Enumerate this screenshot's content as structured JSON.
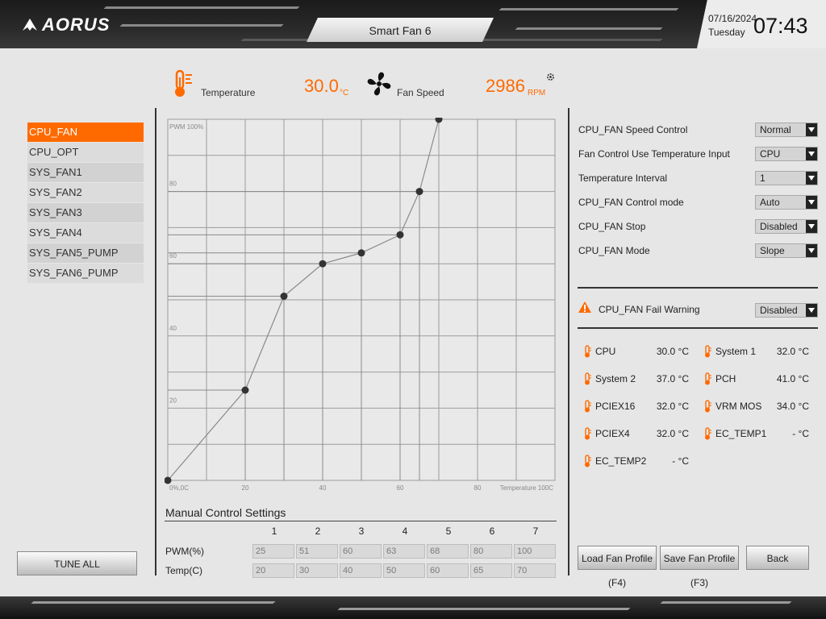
{
  "header": {
    "brand": "AORUS",
    "page_title": "Smart Fan 6",
    "date": "07/16/2024",
    "day": "Tuesday",
    "time": "07:43"
  },
  "readouts": {
    "temperature_label": "Temperature",
    "temperature_value": "30.0",
    "temperature_unit": "°C",
    "fan_speed_label": "Fan Speed",
    "fan_speed_value": "2986",
    "fan_speed_unit": "RPM"
  },
  "fan_list": [
    {
      "label": "CPU_FAN",
      "active": true
    },
    {
      "label": "CPU_OPT",
      "active": false
    },
    {
      "label": "SYS_FAN1",
      "active": false
    },
    {
      "label": "SYS_FAN2",
      "active": false
    },
    {
      "label": "SYS_FAN3",
      "active": false
    },
    {
      "label": "SYS_FAN4",
      "active": false
    },
    {
      "label": "SYS_FAN5_PUMP",
      "active": false
    },
    {
      "label": "SYS_FAN6_PUMP",
      "active": false
    }
  ],
  "tune_all_label": "TUNE ALL",
  "chart_data": {
    "type": "line",
    "title": "",
    "ylabel": "PWM 100%",
    "xlabel": "Temperature 100C",
    "origin_label": "0%,0C",
    "xlim": [
      0,
      100
    ],
    "ylim": [
      0,
      100
    ],
    "x_ticks": [
      20,
      40,
      60,
      80
    ],
    "y_ticks": [
      20,
      40,
      60,
      80
    ],
    "grid": true,
    "series": [
      {
        "x": [
          0,
          20,
          30,
          40,
          50,
          60,
          65,
          70
        ],
        "y": [
          0,
          25,
          51,
          60,
          63,
          68,
          80,
          100
        ]
      }
    ]
  },
  "manual": {
    "title": "Manual Control Settings",
    "columns": [
      "1",
      "2",
      "3",
      "4",
      "5",
      "6",
      "7"
    ],
    "pwm_label": "PWM(%)",
    "temp_label": "Temp(C)",
    "pwm": [
      "25",
      "51",
      "60",
      "63",
      "68",
      "80",
      "100"
    ],
    "temp": [
      "20",
      "30",
      "40",
      "50",
      "60",
      "65",
      "70"
    ]
  },
  "settings": [
    {
      "label": "CPU_FAN Speed Control",
      "value": "Normal"
    },
    {
      "label": "Fan Control Use Temperature Input",
      "value": "CPU"
    },
    {
      "label": "Temperature Interval",
      "value": "1"
    },
    {
      "label": "CPU_FAN Control mode",
      "value": "Auto"
    },
    {
      "label": "CPU_FAN Stop",
      "value": "Disabled"
    },
    {
      "label": "CPU_FAN Mode",
      "value": "Slope"
    }
  ],
  "fail_warning": {
    "label": "CPU_FAN Fail Warning",
    "value": "Disabled"
  },
  "sensors": [
    {
      "name": "CPU",
      "value": "30.0 °C"
    },
    {
      "name": "System 1",
      "value": "32.0 °C"
    },
    {
      "name": "System 2",
      "value": "37.0 °C"
    },
    {
      "name": "PCH",
      "value": "41.0 °C"
    },
    {
      "name": "PCIEX16",
      "value": "32.0 °C"
    },
    {
      "name": "VRM MOS",
      "value": "34.0 °C"
    },
    {
      "name": "PCIEX4",
      "value": "32.0 °C"
    },
    {
      "name": "EC_TEMP1",
      "value": "- °C"
    },
    {
      "name": "EC_TEMP2",
      "value": "- °C"
    }
  ],
  "buttons": {
    "load": "Load Fan Profile (F4)",
    "save": "Save Fan Profile (F3)",
    "back": "Back"
  },
  "colors": {
    "accent": "#ff6a00",
    "chart_bg": "#e9e9e9",
    "grid": "#9c9c9c",
    "line": "#8a8a8a",
    "point": "#333333"
  }
}
